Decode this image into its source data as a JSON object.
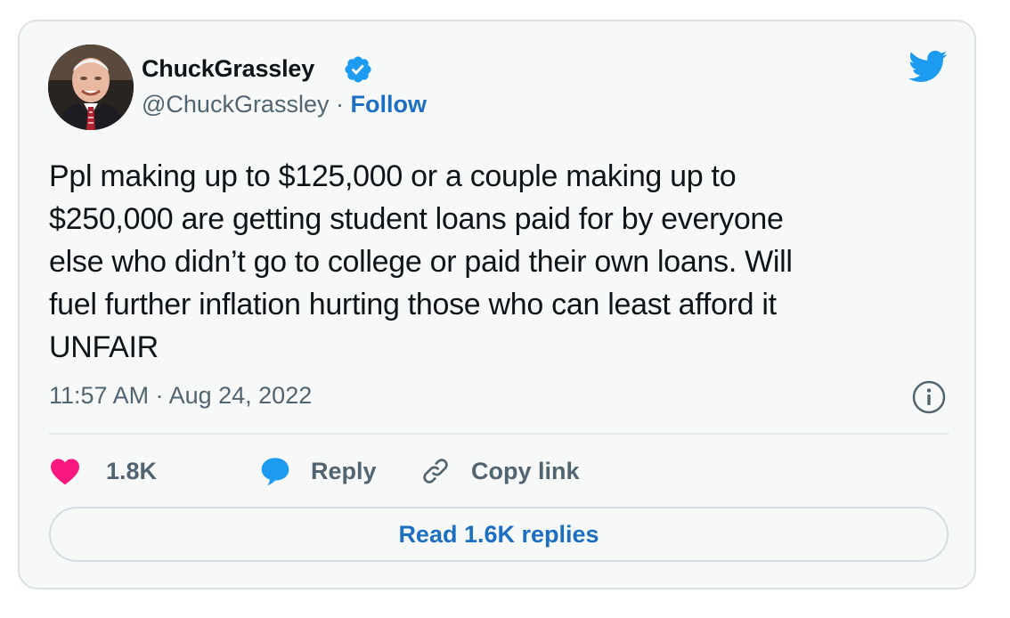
{
  "author": {
    "display_name": "ChuckGrassley",
    "handle": "@ChuckGrassley",
    "separator": "·",
    "follow_label": "Follow",
    "verified": true
  },
  "tweet": {
    "lines": [
      "Ppl making up to $125,000 or a couple making up to",
      "$250,000 are getting student loans paid for by everyone",
      "else who didn’t go to college or paid their own loans. Will",
      "fuel further inflation hurting those who can least afford it",
      "UNFAIR"
    ],
    "timestamp": "11:57 AM · Aug 24, 2022"
  },
  "actions": {
    "like_count": "1.8K",
    "reply_label": "Reply",
    "copy_link_label": "Copy link"
  },
  "read_replies_label": "Read 1.6K replies",
  "icons": {
    "verified": "verified-badge-icon",
    "twitter": "twitter-bird-icon",
    "info": "info-icon",
    "like": "heart-icon",
    "reply": "speech-bubble-icon",
    "link": "link-icon"
  },
  "colors": {
    "card_background": "#f7f9f9",
    "card_border": "#dbe1e5",
    "twitter_blue": "#1d9bf0",
    "link_blue": "#1d6fc2",
    "heart_pink": "#f91880",
    "text_primary": "#0f1419",
    "text_secondary": "#536471"
  }
}
